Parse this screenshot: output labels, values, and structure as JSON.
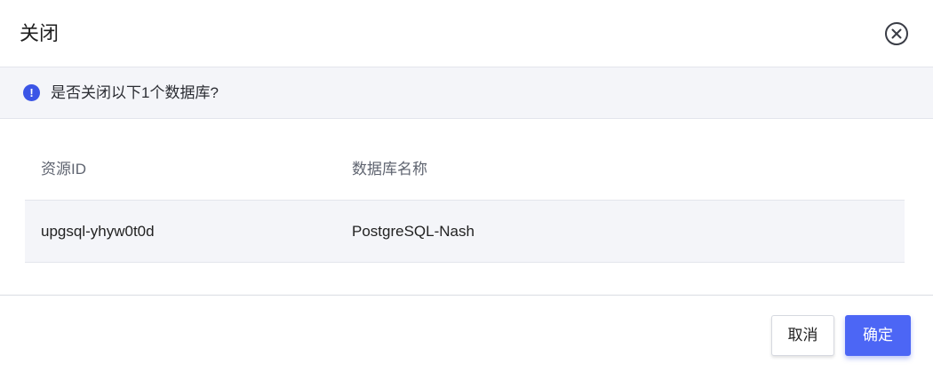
{
  "dialog": {
    "title": "关闭",
    "close_icon": "close-circle-icon"
  },
  "notice": {
    "icon": "exclamation-icon",
    "text": "是否关闭以下1个数据库?"
  },
  "table": {
    "columns": [
      "资源ID",
      "数据库名称"
    ],
    "rows": [
      [
        "upgsql-yhyw0t0d",
        "PostgreSQL-Nash"
      ]
    ]
  },
  "footer": {
    "cancel_label": "取消",
    "ok_label": "确定"
  },
  "colors": {
    "accent": "#4c66f5",
    "notice_bg": "#f4f5f9"
  }
}
